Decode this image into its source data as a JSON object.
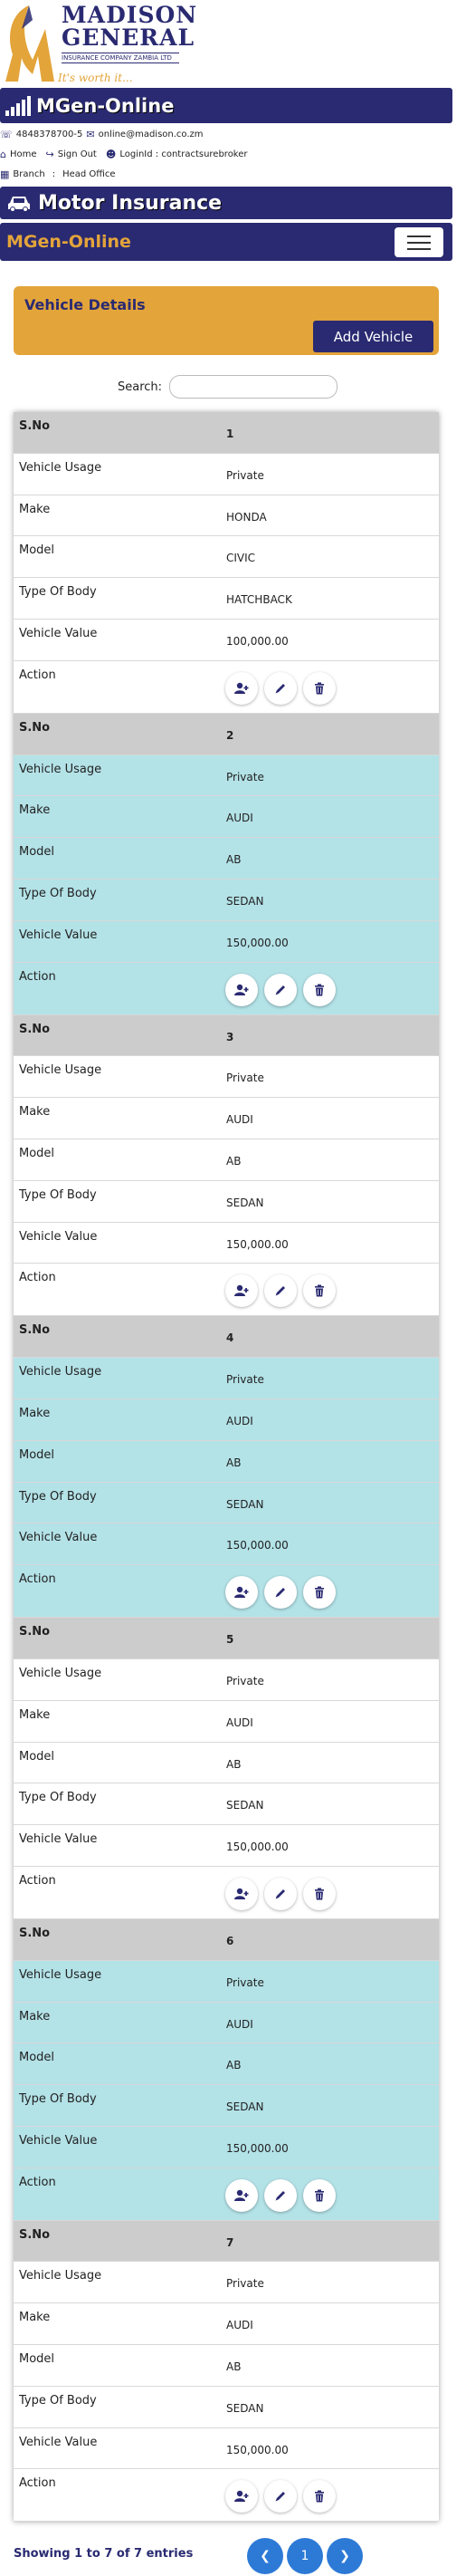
{
  "logo": {
    "line1": "MADISON",
    "line2": "GENERAL",
    "subline": "INSURANCE COMPANY ZAMBIA LTD",
    "tagline": "It's worth it...",
    "colors": {
      "navy": "#2a2a72",
      "gold": "#e3a43a"
    }
  },
  "topbar": {
    "title": "MGen-Online",
    "icon": "signal-bars-icon"
  },
  "contact": {
    "phone": "4848378700-5",
    "email": "online@madison.co.zm",
    "home_label": "Home",
    "signout_label": "Sign Out",
    "loginid_label": "LoginId : contractsurebroker",
    "branch_label": "Branch",
    "branch_sep": ":",
    "branch_value": "Head Office"
  },
  "motorbar": {
    "title": "Motor Insurance",
    "icon": "car-icon"
  },
  "navbar": {
    "brand": "MGen-Online",
    "toggler_icon": "hamburger-icon"
  },
  "vehicle_header": {
    "title": "Vehicle Details",
    "add_label": "Add Vehicle"
  },
  "search": {
    "label": "Search:",
    "value": "",
    "placeholder": ""
  },
  "table": {
    "labels": {
      "sno": "S.No",
      "usage": "Vehicle Usage",
      "make": "Make",
      "model": "Model",
      "body": "Type Of Body",
      "value": "Vehicle Value",
      "action": "Action"
    },
    "records": [
      {
        "sno": "1",
        "usage": "Private",
        "make": "HONDA",
        "model": "CIVIC",
        "body": "HATCHBACK",
        "value": "100,000.00"
      },
      {
        "sno": "2",
        "usage": "Private",
        "make": "AUDI",
        "model": "AB",
        "body": "SEDAN",
        "value": "150,000.00"
      },
      {
        "sno": "3",
        "usage": "Private",
        "make": "AUDI",
        "model": "AB",
        "body": "SEDAN",
        "value": "150,000.00"
      },
      {
        "sno": "4",
        "usage": "Private",
        "make": "AUDI",
        "model": "AB",
        "body": "SEDAN",
        "value": "150,000.00"
      },
      {
        "sno": "5",
        "usage": "Private",
        "make": "AUDI",
        "model": "AB",
        "body": "SEDAN",
        "value": "150,000.00"
      },
      {
        "sno": "6",
        "usage": "Private",
        "make": "AUDI",
        "model": "AB",
        "body": "SEDAN",
        "value": "150,000.00"
      },
      {
        "sno": "7",
        "usage": "Private",
        "make": "AUDI",
        "model": "AB",
        "body": "SEDAN",
        "value": "150,000.00"
      }
    ],
    "action_icons": [
      "add-driver-icon",
      "edit-icon",
      "delete-icon"
    ],
    "row_colors": {
      "header": "#cccccc",
      "odd": "#ffffff",
      "even": "#b3e2e7"
    }
  },
  "footer": {
    "showing": "Showing 1 to 7 of 7 entries",
    "page": "1",
    "prev_icon": "chevron-left-icon",
    "next_icon": "chevron-right-icon",
    "pager_color": "#2d7ad6"
  }
}
